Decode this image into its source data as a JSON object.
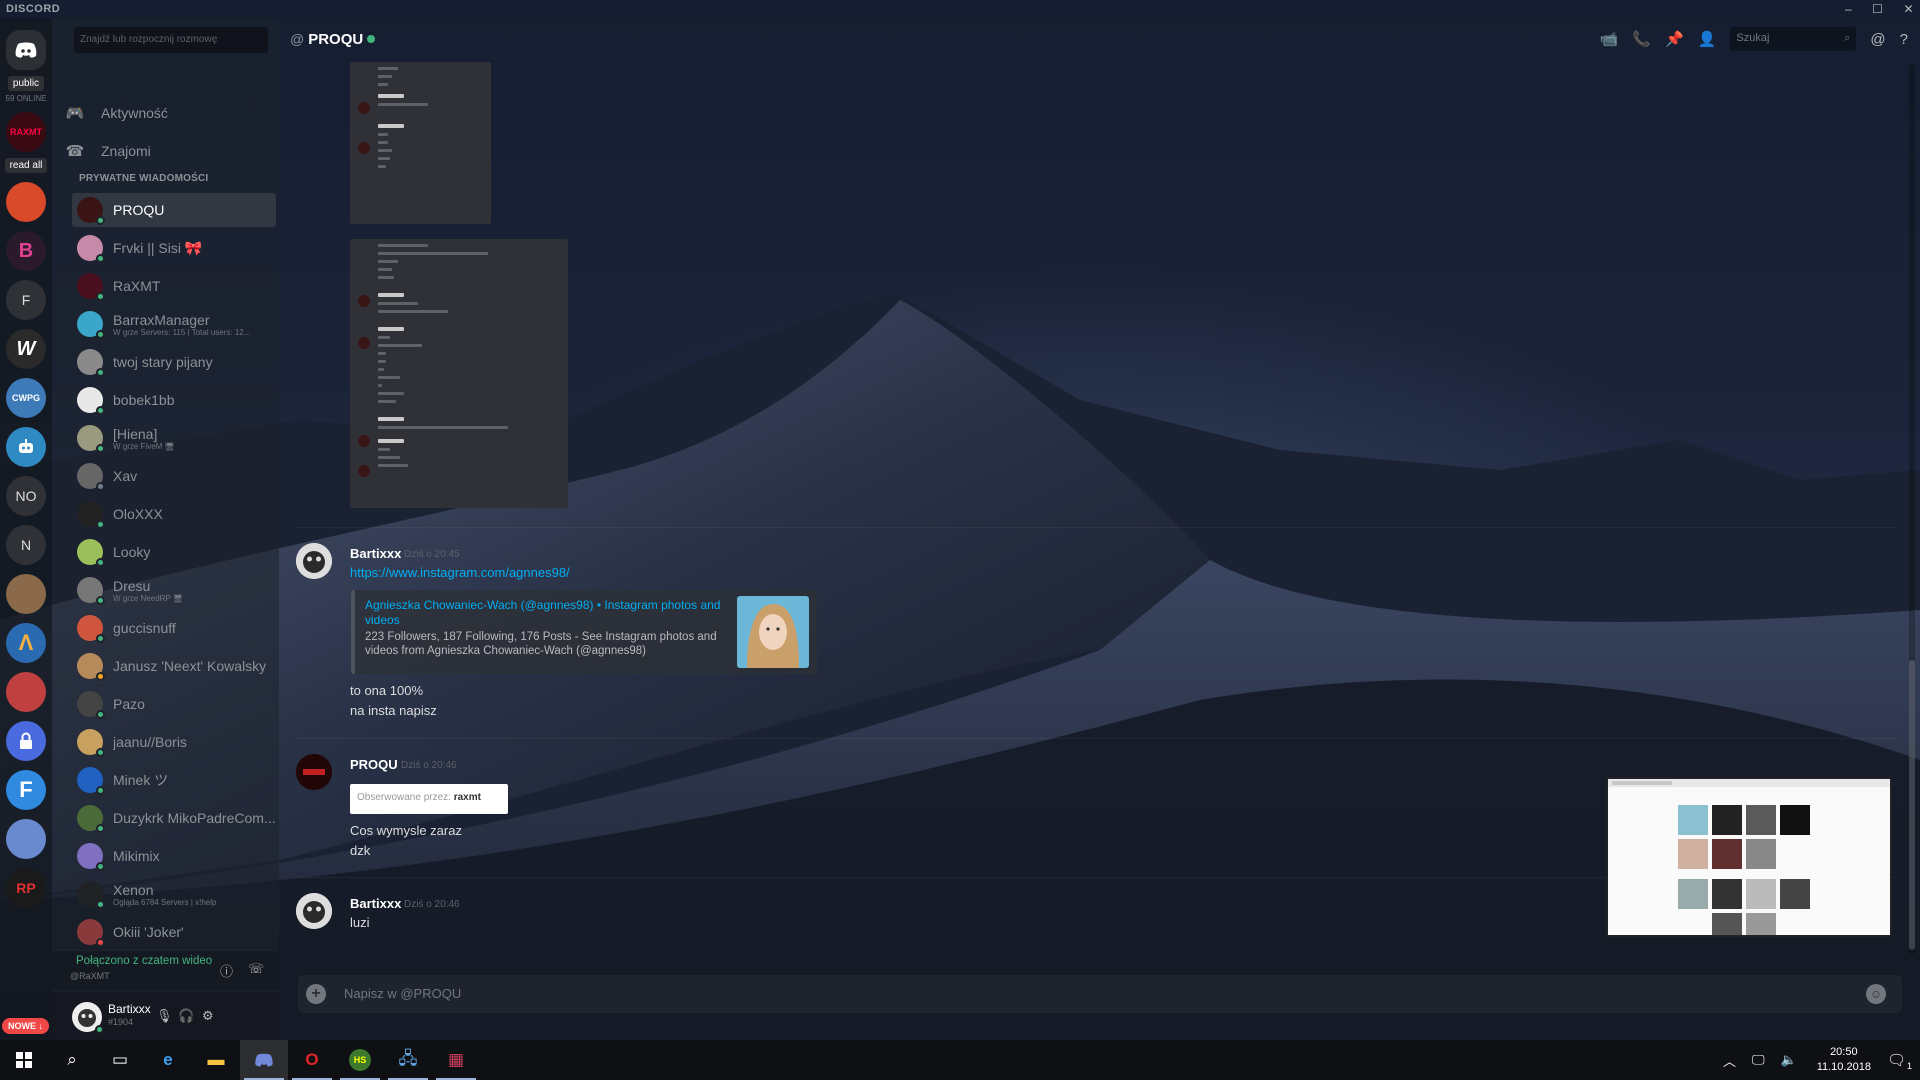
{
  "app": {
    "name": "DISCORD",
    "window_controls": [
      "–",
      "☐",
      "✕"
    ]
  },
  "servers": {
    "public_label": "public",
    "online_count": "59 ONLINE",
    "read_all_label": "read all",
    "letter_servers": [
      "F",
      "NO",
      "N"
    ],
    "new_badge": "NOWE ↓"
  },
  "dms": {
    "search_placeholder": "Znajdź lub rozpocznij rozmowę",
    "nav": [
      {
        "label": "Aktywność",
        "icon": "gamepad-icon"
      },
      {
        "label": "Znajomi",
        "icon": "friends-icon"
      }
    ],
    "header": "PRYWATNE WIADOMOŚCI",
    "items": [
      {
        "name": "PROQU",
        "sub": "",
        "status": "online",
        "color": "#3a1414"
      },
      {
        "name": "Frvki || Sisi 🎀",
        "sub": "",
        "status": "online",
        "color": "#c48aa8"
      },
      {
        "name": "RaXMT",
        "sub": "",
        "status": "online",
        "color": "#4a1020"
      },
      {
        "name": "BarraxManager",
        "sub": "W grze Servers: 115 | Total users: 12...",
        "status": "online",
        "color": "#3aa6c9"
      },
      {
        "name": "twoj stary pijany",
        "sub": "",
        "status": "online",
        "color": "#8a8a8a"
      },
      {
        "name": "bobek1bb",
        "sub": "",
        "status": "online",
        "color": "#e8e8e8"
      },
      {
        "name": "[Hiena]",
        "sub": "W grze FiveM 🖥",
        "status": "online",
        "color": "#9a9a80"
      },
      {
        "name": "Xav",
        "sub": "",
        "status": "offline",
        "color": "#666"
      },
      {
        "name": "OloXXX",
        "sub": "",
        "status": "online",
        "color": "#222"
      },
      {
        "name": "Looky",
        "sub": "",
        "status": "online",
        "color": "#9bbf5a"
      },
      {
        "name": "Dresu",
        "sub": "W grze NeedRP 🖥",
        "status": "online",
        "color": "#777"
      },
      {
        "name": "guccisnuff",
        "sub": "",
        "status": "online",
        "color": "#d0553e"
      },
      {
        "name": "Janusz 'Neext' Kowalsky",
        "sub": "",
        "status": "idle",
        "color": "#b68a5a"
      },
      {
        "name": "Pazo",
        "sub": "",
        "status": "online",
        "color": "#444"
      },
      {
        "name": "jaanu//Boris",
        "sub": "",
        "status": "online",
        "color": "#c8a060"
      },
      {
        "name": "Minek ツ",
        "sub": "",
        "status": "online",
        "color": "#2060c0"
      },
      {
        "name": "Duzykrk MikoPadreCom...",
        "sub": "",
        "status": "online",
        "color": "#4a6a3a"
      },
      {
        "name": "Mikimix",
        "sub": "",
        "status": "online",
        "color": "#8070c0"
      },
      {
        "name": "Xenon",
        "sub": "Ogląda 6784 Servers | x!help",
        "status": "online",
        "color": "#202225"
      },
      {
        "name": "Okiii 'Joker'",
        "sub": "",
        "status": "dnd",
        "color": "#8a3a3a"
      }
    ]
  },
  "voice": {
    "title": "Połączono z czatem wideo",
    "sub": "@RaXMT"
  },
  "user": {
    "name": "Bartixxx",
    "tag": "#1904"
  },
  "chat": {
    "at_symbol": "@",
    "title": "PROQU",
    "search_placeholder": "Szukaj",
    "composer_placeholder": "Napisz w @PROQU",
    "messages": [
      {
        "author": "Bartixxx",
        "time": "Dziś o 20:45",
        "link": "https://www.instagram.com/agnnes98/",
        "embed_title": "Agnieszka Chowaniec-Wach (@agnnes98) • Instagram photos and videos",
        "embed_desc": "223 Followers, 187 Following, 176 Posts - See Instagram photos and videos from Agnieszka Chowaniec-Wach (@agnnes98)",
        "lines": [
          "to ona 100%",
          "na insta napisz"
        ]
      },
      {
        "author": "PROQU",
        "time": "Dziś o 20:46",
        "card_label": "Obserwowane przez:",
        "card_value": "raxmt",
        "lines": [
          "Cos wymysle zaraz",
          "dzk"
        ]
      },
      {
        "author": "Bartixxx",
        "time": "Dziś o 20:46",
        "lines": [
          "luzi"
        ]
      }
    ]
  },
  "taskbar": {
    "time": "20:50",
    "date": "11.10.2018",
    "notification_count": "1"
  },
  "colors": {
    "online": "#43b581",
    "idle": "#faa61a",
    "dnd": "#f04747",
    "offline": "#747f8d",
    "link": "#00b0f4"
  }
}
